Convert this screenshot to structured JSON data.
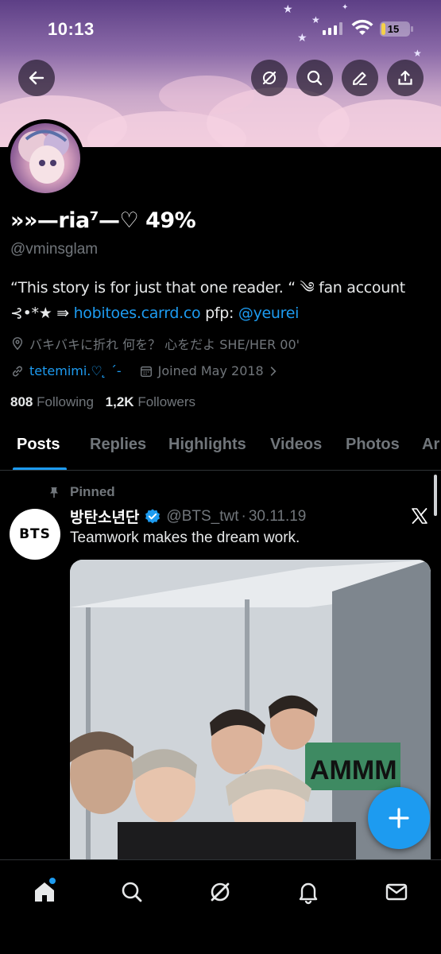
{
  "status_bar": {
    "time": "10:13",
    "battery": "15",
    "battery_level": 0.15
  },
  "header": {
    "back_icon": "arrow-left-icon",
    "actions": [
      "grok-icon",
      "search-icon",
      "edit-icon",
      "share-icon"
    ]
  },
  "profile": {
    "display_name": "»»—ria⁷—♡ 49%",
    "handle": "@vminsglam",
    "bio_line1": "“This story is for just that one reader. “ ༄ fan account",
    "bio_line2_prefix": "⊰•*★ ⇛ ",
    "bio_link": "hobitoes.carrd.co",
    "bio_pfp_label": " pfp: ",
    "bio_mention": "@yeurei",
    "location": "バキバキに折れ 何を？ 心をだよ SHE/HER 00'",
    "website": "tetemimi.♡ ̨̨̨ ´-",
    "joined": "Joined May 2018",
    "following_count": "808",
    "following_label": "Following",
    "followers_count": "1,2K",
    "followers_label": "Followers"
  },
  "tabs": [
    "Posts",
    "Replies",
    "Highlights",
    "Videos",
    "Photos",
    "Ar"
  ],
  "active_tab": "Posts",
  "pinned_post": {
    "pinned_label": "Pinned",
    "avatar_text": "BTS",
    "author_name": "방탄소년단",
    "author_handle": "@BTS_twt",
    "separator": "·",
    "date": "30.11.19",
    "text": "Teamwork makes the dream work.",
    "photo_sign_text": "AMMM"
  },
  "bottom_nav": [
    "home-icon",
    "search-icon",
    "grok-icon",
    "notifications-icon",
    "messages-icon"
  ],
  "colors": {
    "accent": "#1d9bf0",
    "muted": "#71767b",
    "text": "#e7e9ea",
    "background": "#000000"
  }
}
